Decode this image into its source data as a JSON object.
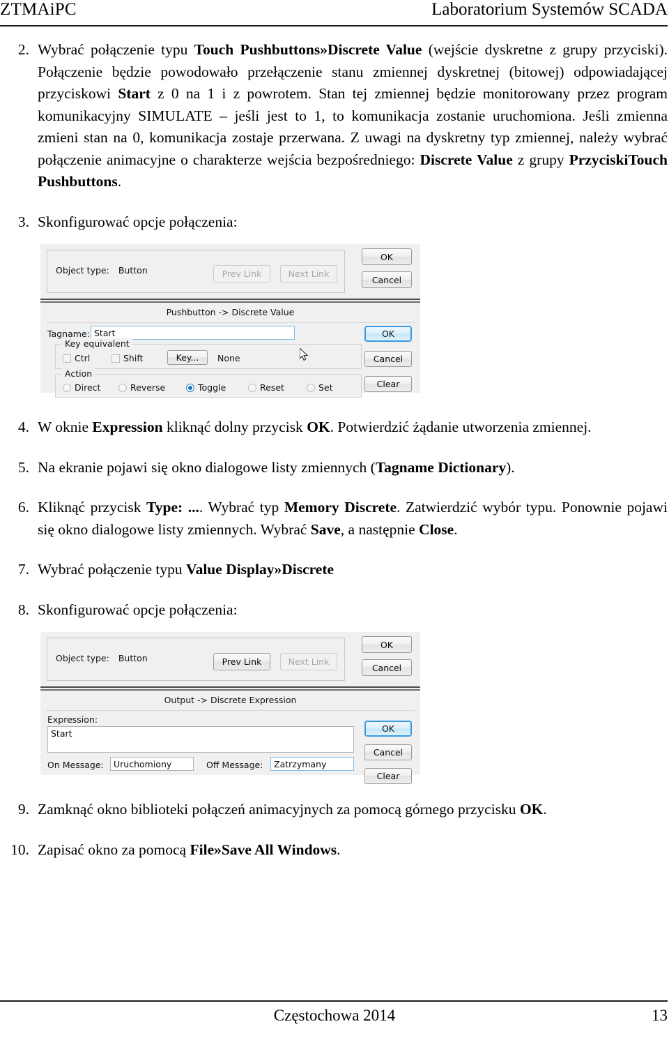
{
  "header": {
    "left": "ZTMAiPC",
    "right": "Laboratorium Systemów SCADA"
  },
  "footer": {
    "center": "Częstochowa 2014",
    "page_number": "13"
  },
  "steps": {
    "s2": {
      "num": "2.",
      "p1": "Wybrać połączenie typu ",
      "b1": "Touch Pushbuttons»Discrete Value",
      "p2": " (wejście dyskretne z grupy przyciski). Połączenie będzie powodowało przełączenie stanu zmiennej dyskretnej (bitowej) odpowiadającej przyciskowi ",
      "b2": "Start",
      "p3": " z 0 na 1 i z powrotem. Stan tej zmiennej będzie monitorowany przez program komunikacyjny SIMULATE – jeśli jest to 1, to komunikacja zostanie uruchomiona. Jeśli zmienna zmieni stan na 0, komunikacja zostaje przerwana. Z uwagi na dyskretny typ zmiennej, należy wybrać połączenie animacyjne o charakterze wejścia bezpośredniego: ",
      "b3": "Discrete Value",
      "p4": " z grupy ",
      "b4": "PrzyciskiTouch Pushbuttons",
      "p5": "."
    },
    "s3": {
      "num": "3.",
      "p1": "Skonfigurować opcje połączenia:"
    },
    "s4": {
      "num": "4.",
      "p1": "W oknie ",
      "b1": "Expression",
      "p2": " kliknąć dolny przycisk ",
      "b2": "OK",
      "p3": ". Potwierdzić żądanie utworzenia zmiennej."
    },
    "s5": {
      "num": "5.",
      "p1": "Na ekranie pojawi się okno dialogowe listy zmiennych (",
      "b1": "Tagname Dictionary",
      "p2": ")."
    },
    "s6": {
      "num": "6.",
      "p1": "Kliknąć przycisk ",
      "b1": "Type: ...",
      "p2": ". Wybrać typ ",
      "b2": "Memory Discrete",
      "p3": ". Zatwierdzić wybór typu. Ponownie pojawi się okno dialogowe listy zmiennych. Wybrać ",
      "b3": "Save",
      "p4": ", a następnie ",
      "b4": "Close",
      "p5": "."
    },
    "s7": {
      "num": "7.",
      "p1": "Wybrać połączenie typu ",
      "b1": "Value Display»Discrete"
    },
    "s8": {
      "num": "8.",
      "p1": "Skonfigurować opcje połączenia:"
    },
    "s9": {
      "num": "9.",
      "p1": "Zamknąć okno biblioteki połączeń animacyjnych za pomocą górnego przycisku ",
      "b1": "OK",
      "p2": "."
    },
    "s10": {
      "num": "10.",
      "p1": "Zapisać okno za pomocą ",
      "b1": "File»Save All Windows",
      "p2": "."
    }
  },
  "dialog1": {
    "object_type_label": "Object type:",
    "object_type_value": "Button",
    "prev_link": "Prev Link",
    "next_link": "Next Link",
    "ok_top": "OK",
    "cancel_top": "Cancel",
    "pane_title": "Pushbutton -> Discrete Value",
    "tagname_label": "Tagname:",
    "tagname_value": "Start",
    "key_equivalent_title": "Key equivalent",
    "ctrl_label": "Ctrl",
    "shift_label": "Shift",
    "key_button": "Key...",
    "key_value": "None",
    "action_title": "Action",
    "actions": [
      {
        "label": "Direct",
        "selected": false
      },
      {
        "label": "Reverse",
        "selected": false
      },
      {
        "label": "Toggle",
        "selected": true
      },
      {
        "label": "Reset",
        "selected": false
      },
      {
        "label": "Set",
        "selected": false
      }
    ],
    "ok_bottom": "OK",
    "cancel_bottom": "Cancel",
    "clear_bottom": "Clear"
  },
  "dialog2": {
    "object_type_label": "Object type:",
    "object_type_value": "Button",
    "prev_link": "Prev Link",
    "next_link": "Next Link",
    "ok_top": "OK",
    "cancel_top": "Cancel",
    "pane_title": "Output -> Discrete Expression",
    "expression_label": "Expression:",
    "expression_value": "Start",
    "on_message_label": "On Message:",
    "on_message_value": "Uruchomiony",
    "off_message_label": "Off Message:",
    "off_message_value": "Zatrzymany",
    "ok_bottom": "OK",
    "cancel_bottom": "Cancel",
    "clear_bottom": "Clear"
  },
  "colors": {
    "focus_border": "#3d9ae0",
    "radio_selected": "#1675c4",
    "dialog_face": "#f0f0f0"
  }
}
